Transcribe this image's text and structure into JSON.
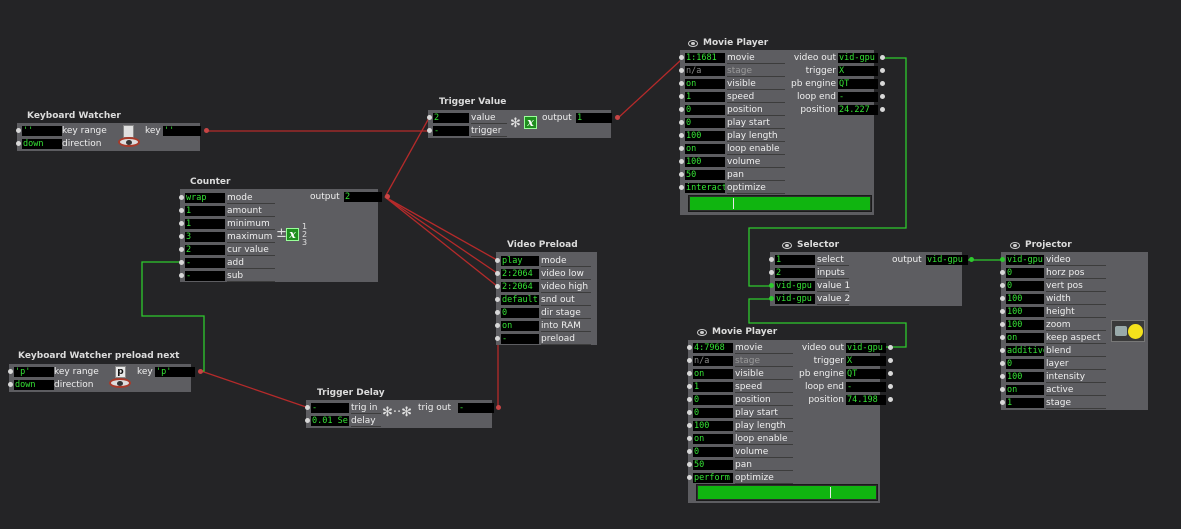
{
  "actors": {
    "kw": {
      "title": "Keyboard Watcher",
      "key_range": {
        "value": "''",
        "label": "key range"
      },
      "direction": {
        "value": "down",
        "label": "direction"
      },
      "key": {
        "label": "key",
        "value": "''"
      }
    },
    "kwp": {
      "title": "Keyboard Watcher preload next",
      "key_range": {
        "value": "'p'",
        "label": "key range"
      },
      "direction": {
        "value": "down",
        "label": "direction"
      },
      "key_glyph": "p",
      "key": {
        "label": "key",
        "value": "'p'"
      }
    },
    "counter": {
      "title": "Counter",
      "inputs": [
        {
          "value": "wrap",
          "label": "mode"
        },
        {
          "value": "1",
          "label": "amount"
        },
        {
          "value": "1",
          "label": "minimum"
        },
        {
          "value": "3",
          "label": "maximum"
        },
        {
          "value": "2",
          "label": "cur value"
        },
        {
          "value": "-",
          "label": "add"
        },
        {
          "value": "-",
          "label": "sub"
        }
      ],
      "output": {
        "label": "output",
        "value": "2"
      },
      "icon_text": "±",
      "icon_var": "x",
      "fraction": [
        "1",
        "2",
        "3"
      ]
    },
    "tv": {
      "title": "Trigger Value",
      "inputs": [
        {
          "value": "2",
          "label": "value"
        },
        {
          "value": "-",
          "label": "trigger"
        }
      ],
      "output": {
        "label": "output",
        "value": "1"
      },
      "icon_var": "x"
    },
    "td": {
      "title": "Trigger Delay",
      "inputs": [
        {
          "value": "-",
          "label": "trig in"
        },
        {
          "value": "0.01 Se",
          "label": "delay"
        }
      ],
      "output": {
        "label": "trig out",
        "value": "-"
      }
    },
    "vp": {
      "title": "Video Preload",
      "inputs": [
        {
          "value": "play",
          "label": "mode"
        },
        {
          "value": "2:2064",
          "label": "video low"
        },
        {
          "value": "2:2064",
          "label": "video high"
        },
        {
          "value": "default",
          "label": "snd out"
        },
        {
          "value": "0",
          "label": "dir stage"
        },
        {
          "value": "on",
          "label": "into RAM"
        },
        {
          "value": "-",
          "label": "preload"
        }
      ]
    },
    "mp1": {
      "title": "Movie Player",
      "inputs": [
        {
          "value": "1:1681",
          "label": "movie"
        },
        {
          "value": "n/a",
          "label": "stage",
          "dim": true
        },
        {
          "value": "on",
          "label": "visible"
        },
        {
          "value": "1",
          "label": "speed"
        },
        {
          "value": "0",
          "label": "position"
        },
        {
          "value": "0",
          "label": "play start"
        },
        {
          "value": "100",
          "label": "play length"
        },
        {
          "value": "on",
          "label": "loop enable"
        },
        {
          "value": "100",
          "label": "volume"
        },
        {
          "value": "50",
          "label": "pan"
        },
        {
          "value": "interact",
          "label": "optimize"
        }
      ],
      "outputs": [
        {
          "label": "video out",
          "value": "vid-gpu"
        },
        {
          "label": "trigger",
          "value": "X"
        },
        {
          "label": "pb engine",
          "value": "QT"
        },
        {
          "label": "loop end",
          "value": "-"
        },
        {
          "label": "position",
          "value": "24.227"
        }
      ],
      "progress": 0.24
    },
    "mp2": {
      "title": "Movie Player",
      "inputs": [
        {
          "value": "4:7968",
          "label": "movie"
        },
        {
          "value": "n/a",
          "label": "stage",
          "dim": true
        },
        {
          "value": "on",
          "label": "visible"
        },
        {
          "value": "1",
          "label": "speed"
        },
        {
          "value": "0",
          "label": "position"
        },
        {
          "value": "0",
          "label": "play start"
        },
        {
          "value": "100",
          "label": "play length"
        },
        {
          "value": "on",
          "label": "loop enable"
        },
        {
          "value": "0",
          "label": "volume"
        },
        {
          "value": "50",
          "label": "pan"
        },
        {
          "value": "perform",
          "label": "optimize"
        }
      ],
      "outputs": [
        {
          "label": "video out",
          "value": "vid-gpu"
        },
        {
          "label": "trigger",
          "value": "X"
        },
        {
          "label": "pb engine",
          "value": "QT"
        },
        {
          "label": "loop end",
          "value": "-"
        },
        {
          "label": "position",
          "value": "74.198"
        }
      ],
      "progress": 0.74
    },
    "sel": {
      "title": "Selector",
      "inputs": [
        {
          "value": "1",
          "label": "select"
        },
        {
          "value": "2",
          "label": "inputs"
        },
        {
          "value": "vid-gpu",
          "label": "value 1"
        },
        {
          "value": "vid-gpu",
          "label": "value 2"
        }
      ],
      "output": {
        "label": "output",
        "value": "vid-gpu"
      }
    },
    "proj": {
      "title": "Projector",
      "inputs": [
        {
          "value": "vid-gpu",
          "label": "video"
        },
        {
          "value": "0",
          "label": "horz pos"
        },
        {
          "value": "0",
          "label": "vert pos"
        },
        {
          "value": "100",
          "label": "width"
        },
        {
          "value": "100",
          "label": "height"
        },
        {
          "value": "100",
          "label": "zoom"
        },
        {
          "value": "on",
          "label": "keep aspect"
        },
        {
          "value": "additive",
          "label": "blend"
        },
        {
          "value": "0",
          "label": "layer"
        },
        {
          "value": "100",
          "label": "intensity"
        },
        {
          "value": "on",
          "label": "active"
        },
        {
          "value": "1",
          "label": "stage"
        }
      ]
    }
  },
  "colors": {
    "canvas": "#242426",
    "actor_body": "#5d5d61",
    "value_text": "#35e235",
    "trigger_wire": "#b52a2a",
    "video_wire": "#2ec92e",
    "progress": "#10b510"
  }
}
